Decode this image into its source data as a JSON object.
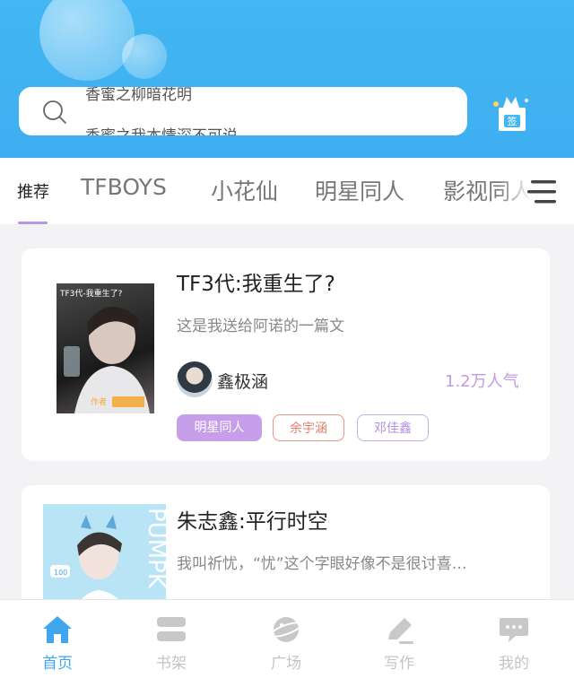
{
  "header": {
    "search_placeholder_prev": "香蜜之柳暗花明",
    "search_placeholder_next": "香蜜之我本情深不可说",
    "checkin_label": "签"
  },
  "tabs": [
    {
      "label": "推荐",
      "active": true
    },
    {
      "label": "TFBOYS"
    },
    {
      "label": "小花仙"
    },
    {
      "label": "明星同人"
    },
    {
      "label": "影视同人"
    }
  ],
  "books": [
    {
      "title": "TF3代:我重生了?",
      "description": "这是我送给阿诺的一篇文",
      "author": "鑫极涵",
      "popularity": "1.2万人气",
      "cover_text": "TF3代-我重生了?",
      "cover_badge": "作者",
      "tags": [
        "明星同人",
        "余宇涵",
        "邓佳鑫"
      ]
    },
    {
      "title": "朱志鑫:平行时空",
      "description": "我叫祈忧，“忧”这个字眼好像不是很讨喜…",
      "cover_text": "PUMPK",
      "cover_count": "100"
    }
  ],
  "bottom_nav": [
    {
      "label": "首页",
      "icon": "home-icon",
      "active": true
    },
    {
      "label": "书架",
      "icon": "bookshelf-icon"
    },
    {
      "label": "广场",
      "icon": "planet-icon"
    },
    {
      "label": "写作",
      "icon": "pen-icon"
    },
    {
      "label": "我的",
      "icon": "chat-bubble-icon"
    }
  ],
  "colors": {
    "header_blue": "#3eaef0",
    "accent_purple": "#c79ee9",
    "nav_active": "#3ea7ef"
  }
}
